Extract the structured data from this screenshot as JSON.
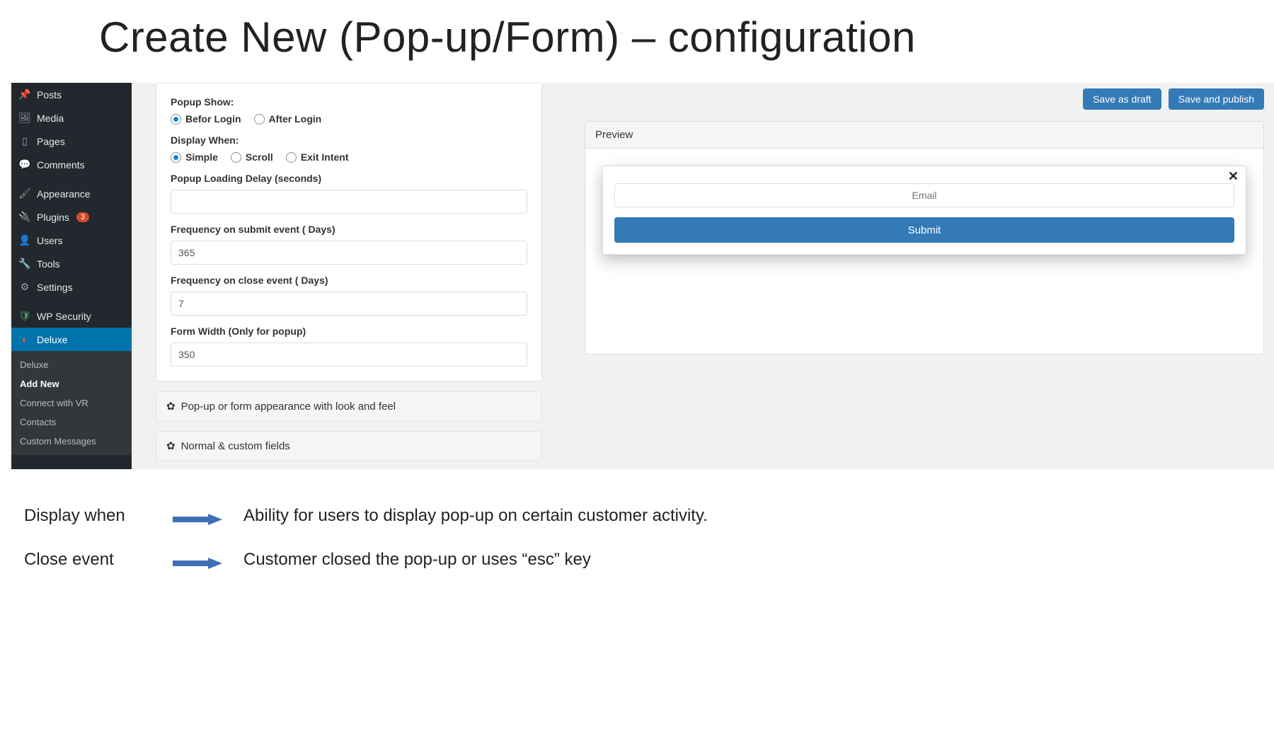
{
  "slide_title": "Create New (Pop-up/Form) – configuration",
  "sidebar": {
    "items": [
      {
        "name": "posts",
        "label": "Posts",
        "icon": "📌"
      },
      {
        "name": "media",
        "label": "Media",
        "icon": "🖼"
      },
      {
        "name": "pages",
        "label": "Pages",
        "icon": "▯"
      },
      {
        "name": "comments",
        "label": "Comments",
        "icon": "💬"
      },
      {
        "name": "appearance",
        "label": "Appearance",
        "icon": "🖌"
      },
      {
        "name": "plugins",
        "label": "Plugins",
        "icon": "🔌",
        "badge": "3"
      },
      {
        "name": "users",
        "label": "Users",
        "icon": "👤"
      },
      {
        "name": "tools",
        "label": "Tools",
        "icon": "🔧"
      },
      {
        "name": "settings",
        "label": "Settings",
        "icon": "⚙"
      },
      {
        "name": "wp-security",
        "label": "WP Security",
        "icon": "🛡"
      },
      {
        "name": "deluxe",
        "label": "Deluxe",
        "icon": "◐",
        "active": true
      }
    ],
    "sub": [
      {
        "label": "Deluxe"
      },
      {
        "label": "Add New",
        "bold": true
      },
      {
        "label": "Connect with VR"
      },
      {
        "label": "Contacts"
      },
      {
        "label": "Custom Messages"
      }
    ]
  },
  "form": {
    "popup_show_label": "Popup Show:",
    "popup_show_options": [
      {
        "label": "Befor Login",
        "selected": true
      },
      {
        "label": "After Login",
        "selected": false
      }
    ],
    "display_when_label": "Display When:",
    "display_when_options": [
      {
        "label": "Simple",
        "selected": true
      },
      {
        "label": "Scroll",
        "selected": false
      },
      {
        "label": "Exit Intent",
        "selected": false
      }
    ],
    "delay_label": "Popup Loading Delay (seconds)",
    "delay_value": "",
    "freq_submit_label": "Frequency on submit event ( Days)",
    "freq_submit_value": "365",
    "freq_close_label": "Frequency on close event ( Days)",
    "freq_close_value": "7",
    "width_label": "Form Width (Only for popup)",
    "width_value": "350",
    "accordion1": "Pop-up or form appearance with look and feel",
    "accordion2": "Normal & custom fields"
  },
  "buttons": {
    "save_draft": "Save as draft",
    "save_publish": "Save and publish"
  },
  "preview": {
    "heading": "Preview",
    "email_placeholder": "Email",
    "submit_label": "Submit",
    "close": "✕"
  },
  "notes": {
    "row1_label": "Display when",
    "row1_desc": "Ability for users to display pop-up on certain customer activity.",
    "row2_label": "Close event",
    "row2_desc": "Customer closed the pop-up or uses “esc” key"
  }
}
